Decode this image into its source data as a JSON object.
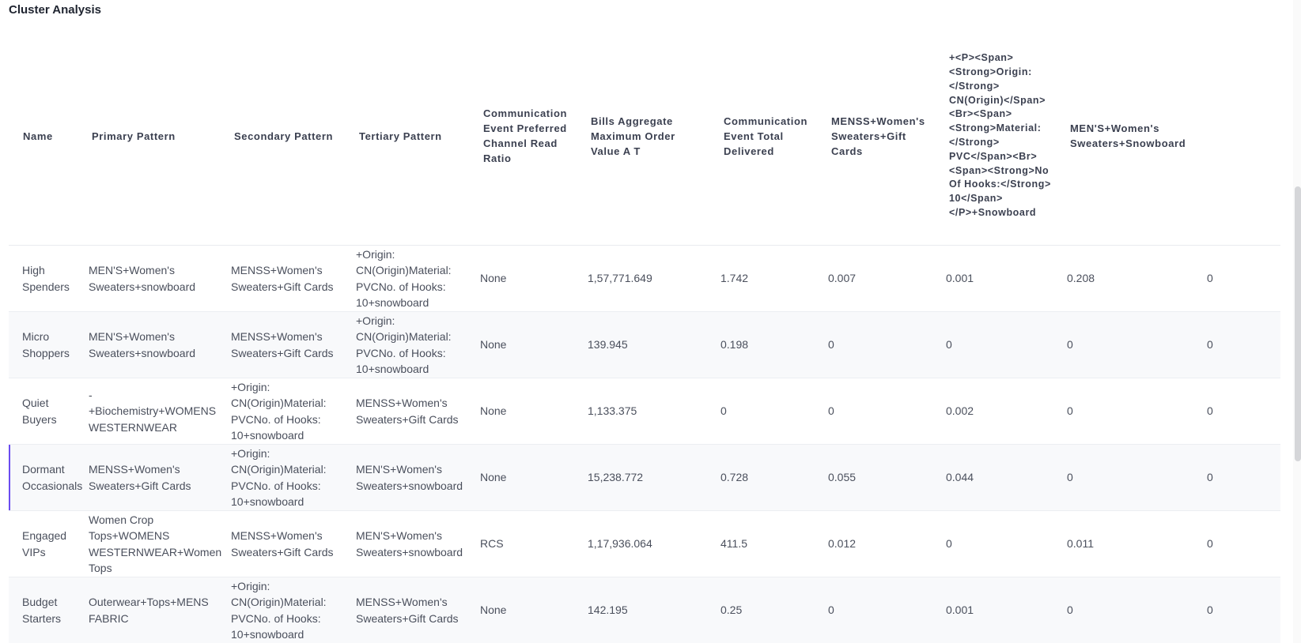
{
  "page": {
    "title": "Cluster Analysis"
  },
  "table": {
    "columns": [
      "Name",
      "Primary Pattern",
      "Secondary Pattern",
      "Tertiary Pattern",
      "Communication Event Preferred Channel Read Ratio",
      "Bills Aggregate Maximum Order Value A T",
      "Communication Event Total Delivered",
      "MENSS+Women's Sweaters+Gift Cards",
      "+<P><Span><Strong>Origin:</Strong> CN(Origin)</Span><Br><Span><Strong>Material:</Strong> PVC</Span><Br><Span><Strong>No Of Hooks:</Strong> 10</Span></P>+Snowboard",
      "MEN'S+Women's Sweaters+Snowboard",
      ""
    ],
    "rows": [
      [
        "High Spenders",
        "MEN'S+Women's Sweaters+snowboard",
        "MENSS+Women's Sweaters+Gift Cards",
        "+Origin: CN(Origin)Material: PVCNo. of Hooks: 10+snowboard",
        "None",
        "1,57,771.649",
        "1.742",
        "0.007",
        "0.001",
        "0.208",
        "0"
      ],
      [
        "Micro Shoppers",
        "MEN'S+Women's Sweaters+snowboard",
        "MENSS+Women's Sweaters+Gift Cards",
        "+Origin: CN(Origin)Material: PVCNo. of Hooks: 10+snowboard",
        "None",
        "139.945",
        "0.198",
        "0",
        "0",
        "0",
        "0"
      ],
      [
        "Quiet Buyers",
        "-+Biochemistry+WOMENS WESTERNWEAR",
        "+Origin: CN(Origin)Material: PVCNo. of Hooks: 10+snowboard",
        "MENSS+Women's Sweaters+Gift Cards",
        "None",
        "1,133.375",
        "0",
        "0",
        "0.002",
        "0",
        "0"
      ],
      [
        "Dormant Occasionals",
        "MENSS+Women's Sweaters+Gift Cards",
        "+Origin: CN(Origin)Material: PVCNo. of Hooks: 10+snowboard",
        "MEN'S+Women's Sweaters+snowboard",
        "None",
        "15,238.772",
        "0.728",
        "0.055",
        "0.044",
        "0",
        "0"
      ],
      [
        "Engaged VIPs",
        "Women Crop Tops+WOMENS WESTERNWEAR+Women Tops",
        "MENSS+Women's Sweaters+Gift Cards",
        "MEN'S+Women's Sweaters+snowboard",
        "RCS",
        "1,17,936.064",
        "411.5",
        "0.012",
        "0",
        "0.011",
        "0"
      ],
      [
        "Budget Starters",
        "Outerwear+Tops+MENS FABRIC",
        "+Origin: CN(Origin)Material: PVCNo. of Hooks: 10+snowboard",
        "MENSS+Women's Sweaters+Gift Cards",
        "None",
        "142.195",
        "0.25",
        "0",
        "0.001",
        "0",
        "0"
      ]
    ]
  },
  "colors": {
    "accent": "#6a4cf0",
    "row_alt": "#f8f9fb",
    "border": "#eceef2"
  }
}
